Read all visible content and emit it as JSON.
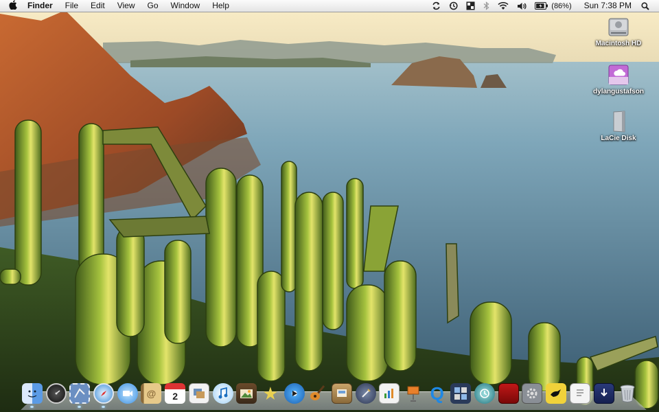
{
  "menubar": {
    "apple_icon": "apple-logo-icon",
    "app_name": "Finder",
    "menus": [
      "File",
      "Edit",
      "View",
      "Go",
      "Window",
      "Help"
    ],
    "status_icons": [
      "sync-icon",
      "time-machine-icon",
      "spaces-icon",
      "bluetooth-icon",
      "wifi-icon",
      "volume-icon",
      "battery-icon"
    ],
    "battery_percent": "(86%)",
    "clock": "Sun 7:38 PM",
    "spotlight_icon": "spotlight-search-icon"
  },
  "desktop": {
    "icons": [
      {
        "label": "Macintosh HD",
        "icon": "hard-drive-icon"
      },
      {
        "label": "dylangustafson",
        "icon": "icloud-drive-icon"
      },
      {
        "label": "LaCie Disk",
        "icon": "external-disk-icon"
      }
    ]
  },
  "dock": {
    "items": [
      {
        "name": "finder",
        "icon": "finder-icon",
        "running": true
      },
      {
        "name": "dashboard",
        "icon": "dashboard-icon",
        "running": false
      },
      {
        "name": "mail-stamp",
        "icon": "mail-icon",
        "running": true
      },
      {
        "name": "safari",
        "icon": "safari-icon",
        "running": true
      },
      {
        "name": "ichat",
        "icon": "ichat-icon",
        "running": false
      },
      {
        "name": "address-book",
        "icon": "address-book-icon",
        "running": false
      },
      {
        "name": "ical",
        "icon": "ical-icon",
        "running": false,
        "badge": "2"
      },
      {
        "name": "preview",
        "icon": "preview-icon",
        "running": false
      },
      {
        "name": "itunes",
        "icon": "itunes-icon",
        "running": false
      },
      {
        "name": "iphoto",
        "icon": "iphoto-icon",
        "running": false
      },
      {
        "name": "imovie",
        "icon": "imovie-icon",
        "running": false
      },
      {
        "name": "idvd",
        "icon": "idvd-icon",
        "running": false
      },
      {
        "name": "garageband",
        "icon": "garageband-icon",
        "running": false
      },
      {
        "name": "iweb",
        "icon": "iweb-icon",
        "running": false
      },
      {
        "name": "script-editor",
        "icon": "script-editor-icon",
        "running": false
      },
      {
        "name": "numbers",
        "icon": "numbers-icon",
        "running": false
      },
      {
        "name": "keynote",
        "icon": "keynote-icon",
        "running": false
      },
      {
        "name": "quicktime",
        "icon": "quicktime-icon",
        "running": false
      },
      {
        "name": "spaces",
        "icon": "spaces-app-icon",
        "running": false
      },
      {
        "name": "time-machine",
        "icon": "time-machine-app-icon",
        "running": false
      },
      {
        "name": "photo-booth",
        "icon": "photo-booth-icon",
        "running": false
      },
      {
        "name": "system-preferences",
        "icon": "system-preferences-icon",
        "running": false
      },
      {
        "name": "twitter",
        "icon": "twitter-bird-icon",
        "running": false
      },
      {
        "name": "documents",
        "icon": "documents-stack-icon",
        "running": false
      },
      {
        "name": "downloads",
        "icon": "downloads-stack-icon",
        "running": false
      },
      {
        "name": "trash",
        "icon": "trash-icon",
        "running": false
      }
    ]
  },
  "colors": {
    "sea": "#6f9bb3",
    "sky": "#f6e6b8",
    "cliff": "#b3582b",
    "cactus": "#8fb03a"
  }
}
